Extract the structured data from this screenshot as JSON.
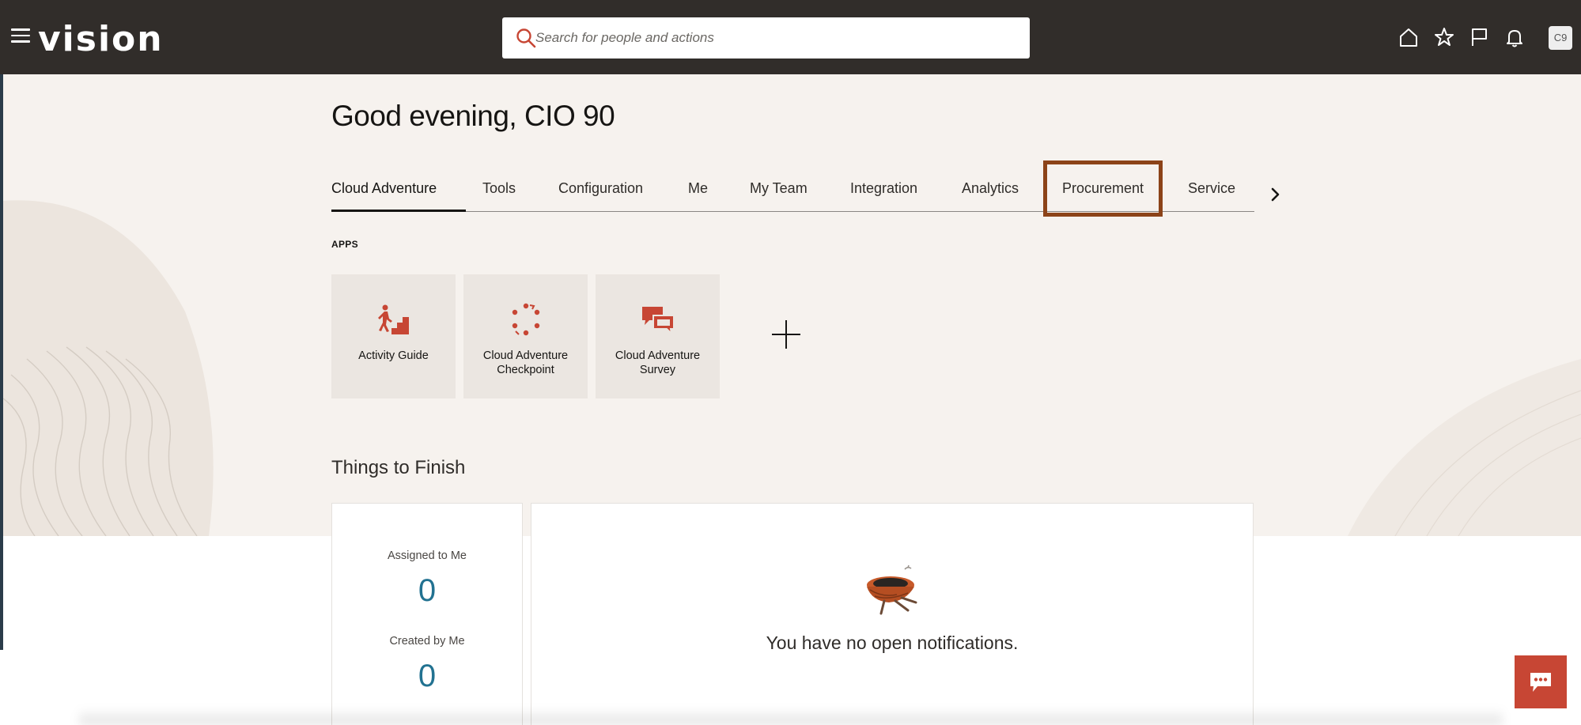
{
  "header": {
    "logo": "vision",
    "search_placeholder": "Search for people and actions",
    "avatar_initials": "C9",
    "icons": [
      "menu-icon",
      "search-icon",
      "home-icon",
      "star-icon",
      "flag-icon",
      "bell-icon"
    ]
  },
  "greeting": "Good evening, CIO 90",
  "tabs": [
    {
      "label": "Cloud Adventure",
      "active": true
    },
    {
      "label": "Tools"
    },
    {
      "label": "Configuration"
    },
    {
      "label": "Me"
    },
    {
      "label": "My Team"
    },
    {
      "label": "Integration"
    },
    {
      "label": "Analytics"
    },
    {
      "label": "Procurement",
      "highlighted": true
    },
    {
      "label": "Service"
    }
  ],
  "apps": {
    "heading": "APPS",
    "tiles": [
      {
        "label": "Activity Guide",
        "icon": "stairs-person-icon"
      },
      {
        "label": "Cloud Adventure Checkpoint",
        "icon": "checkpoint-cycle-icon"
      },
      {
        "label": "Cloud Adventure Survey",
        "icon": "chat-bubbles-icon"
      }
    ]
  },
  "things_to_finish": {
    "title": "Things to Finish",
    "assigned_label": "Assigned to Me",
    "assigned_count": "0",
    "created_label": "Created by Me",
    "created_count": "0",
    "empty_message": "You have no open notifications."
  },
  "colors": {
    "header_bg": "#312d2a",
    "hero_bg": "#f6f2ee",
    "accent": "#c74634",
    "highlight_border": "#8c4318",
    "metric_blue": "#227291"
  }
}
